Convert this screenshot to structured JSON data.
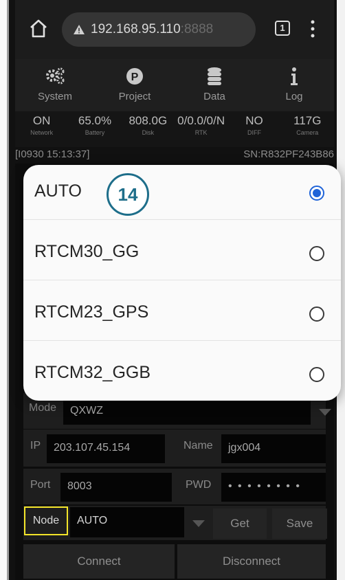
{
  "browser": {
    "url_host": "192.168.95.110",
    "url_port": ":8888",
    "tab_count": "1"
  },
  "nav": [
    {
      "label": "System",
      "icon": "gears-icon"
    },
    {
      "label": "Project",
      "icon": "project-p-icon"
    },
    {
      "label": "Data",
      "icon": "database-icon"
    },
    {
      "label": "Log",
      "icon": "info-icon"
    }
  ],
  "status": [
    {
      "value": "ON",
      "label": "Network"
    },
    {
      "value": "65.0%",
      "label": "Battery"
    },
    {
      "value": "808.0G",
      "label": "Disk"
    },
    {
      "value": "0/0.0/0/N",
      "label": "RTK"
    },
    {
      "value": "NO",
      "label": "DIFF"
    },
    {
      "value": "117G",
      "label": "Camera"
    }
  ],
  "info": {
    "timestamp": "[I0930 15:13:37]",
    "serial": "SN:R832PF243B86"
  },
  "form": {
    "mode_label": "Mode",
    "mode_value": "QXWZ",
    "ip_label": "IP",
    "ip_value": "203.107.45.154",
    "name_label": "Name",
    "name_value": "jgx004",
    "port_label": "Port",
    "port_value": "8003",
    "pwd_label": "PWD",
    "pwd_value": "• • • • • • • •",
    "node_label": "Node",
    "node_value": "AUTO",
    "get_label": "Get",
    "save_label": "Save",
    "connect_label": "Connect",
    "disconnect_label": "Disconnect"
  },
  "dialog": {
    "options": [
      {
        "label": "AUTO",
        "selected": true
      },
      {
        "label": "RTCM30_GG",
        "selected": false
      },
      {
        "label": "RTCM23_GPS",
        "selected": false
      },
      {
        "label": "RTCM32_GGB",
        "selected": false
      }
    ],
    "badge": "14"
  },
  "colors": {
    "accent_radio": "#1f63d8",
    "highlight_box": "#f3e52a",
    "badge": "#1e6e8a"
  }
}
